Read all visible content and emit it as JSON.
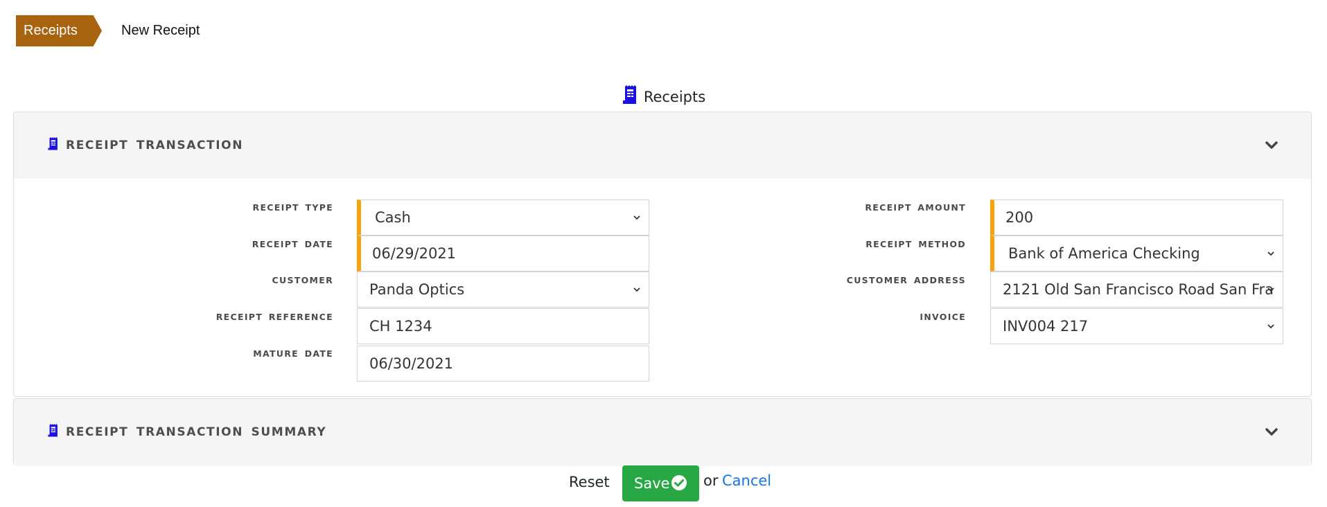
{
  "breadcrumb": {
    "parent": "Receipts",
    "current": "New Receipt"
  },
  "page": {
    "heading": "Receipts",
    "heading_icon": "receipt-icon"
  },
  "sections": [
    {
      "title": "RECEIPT TRANSACTION",
      "icon": "receipt-icon",
      "expanded": true,
      "left_fields": [
        {
          "label": "RECEIPT TYPE",
          "value": "Cash",
          "type": "select",
          "required": true
        },
        {
          "label": "RECEIPT DATE",
          "value": "06/29/2021",
          "type": "date",
          "required": true
        },
        {
          "label": "CUSTOMER",
          "value": "Panda Optics",
          "type": "select",
          "required": false
        },
        {
          "label": "RECEIPT REFERENCE",
          "value": "CH 1234",
          "type": "text",
          "required": false
        },
        {
          "label": "MATURE DATE",
          "value": "06/30/2021",
          "type": "date",
          "required": false
        }
      ],
      "right_fields": [
        {
          "label": "RECEIPT AMOUNT",
          "value": "200",
          "type": "text",
          "required": true
        },
        {
          "label": "RECEIPT METHOD",
          "value": "Bank of America Checking",
          "type": "select",
          "required": true
        },
        {
          "label": "CUSTOMER ADDRESS",
          "value": "2121 Old San Francisco Road San Fra",
          "type": "select",
          "required": false
        },
        {
          "label": "INVOICE",
          "value": "INV004 217",
          "type": "select",
          "required": false
        }
      ]
    },
    {
      "title": "RECEIPT TRANSACTION SUMMARY",
      "icon": "receipt-icon",
      "expanded": false
    }
  ],
  "actions": {
    "reset": "Reset",
    "save": "Save",
    "or": "or",
    "cancel": "Cancel"
  },
  "colors": {
    "breadcrumb": "#a8630f",
    "required_marker": "#f5a40b",
    "save": "#28a745",
    "link": "#1a73e8",
    "icon": "#1a10e0"
  }
}
